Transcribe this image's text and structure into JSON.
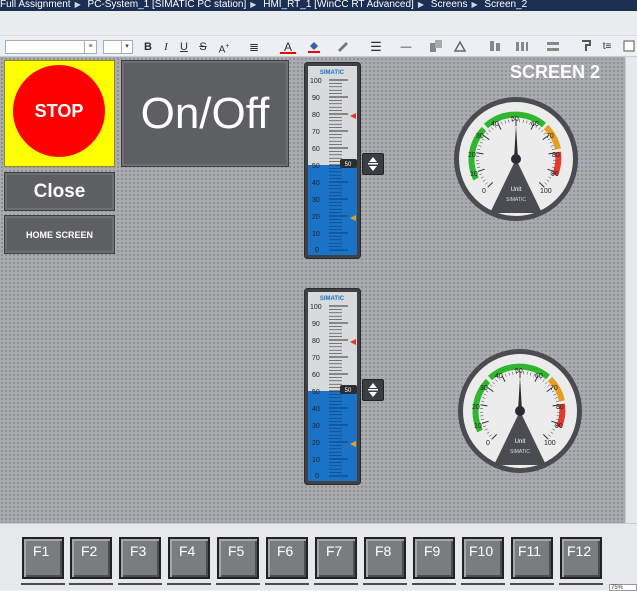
{
  "breadcrumb": {
    "items": [
      "Full Assignment",
      "PC-System_1 [SIMATIC PC station]",
      "HMI_RT_1 [WinCC RT Advanced]",
      "Screens",
      "Screen_2"
    ]
  },
  "toolbar": {
    "font_value": "",
    "size_value": "",
    "icons": [
      "bold",
      "italic",
      "underline",
      "strikethrough",
      "superscript",
      "align",
      "font-color",
      "fill-color",
      "line-color",
      "line-width",
      "line-style",
      "arrange",
      "rotate",
      "align-objects",
      "distribute",
      "group",
      "format-painter",
      "more"
    ]
  },
  "screen": {
    "title": "SCREEN 2",
    "stop_label": "STOP",
    "onoff_label": "On/Off",
    "close_label": "Close",
    "home_label": "HOME SCREEN"
  },
  "bar_gauges": [
    {
      "brand": "SIMATIC",
      "scale_labels": [
        "100",
        "90",
        "80",
        "70",
        "60",
        "50",
        "40",
        "30",
        "20",
        "10",
        "0"
      ],
      "value": 50,
      "value_label": "50",
      "high_marker": 80,
      "low_marker": 20,
      "fill_color": "#1a73c6"
    },
    {
      "brand": "SIMATIC",
      "scale_labels": [
        "100",
        "90",
        "80",
        "70",
        "60",
        "50",
        "40",
        "30",
        "20",
        "10",
        "0"
      ],
      "value": 50,
      "value_label": "50",
      "high_marker": 80,
      "low_marker": 20,
      "fill_color": "#1a73c6"
    }
  ],
  "round_gauges": [
    {
      "scale_labels": [
        "0",
        "10",
        "20",
        "30",
        "40",
        "50",
        "60",
        "70",
        "80",
        "90",
        "100"
      ],
      "unit_label": "Unit",
      "brand": "SIMATIC",
      "value": 50
    },
    {
      "scale_labels": [
        "0",
        "10",
        "20",
        "30",
        "40",
        "50",
        "60",
        "70",
        "80",
        "90",
        "100"
      ],
      "unit_label": "Unit",
      "brand": "SIMATIC",
      "value": 50
    }
  ],
  "function_keys": [
    "F1",
    "F2",
    "F3",
    "F4",
    "F5",
    "F6",
    "F7",
    "F8",
    "F9",
    "F10",
    "F11",
    "F12"
  ],
  "zoom": "75%",
  "colors": {
    "stop_background": "#ffff00",
    "stop_circle": "#ff0000",
    "button": "#5e5f63",
    "title_bar": "#1c2f52"
  }
}
